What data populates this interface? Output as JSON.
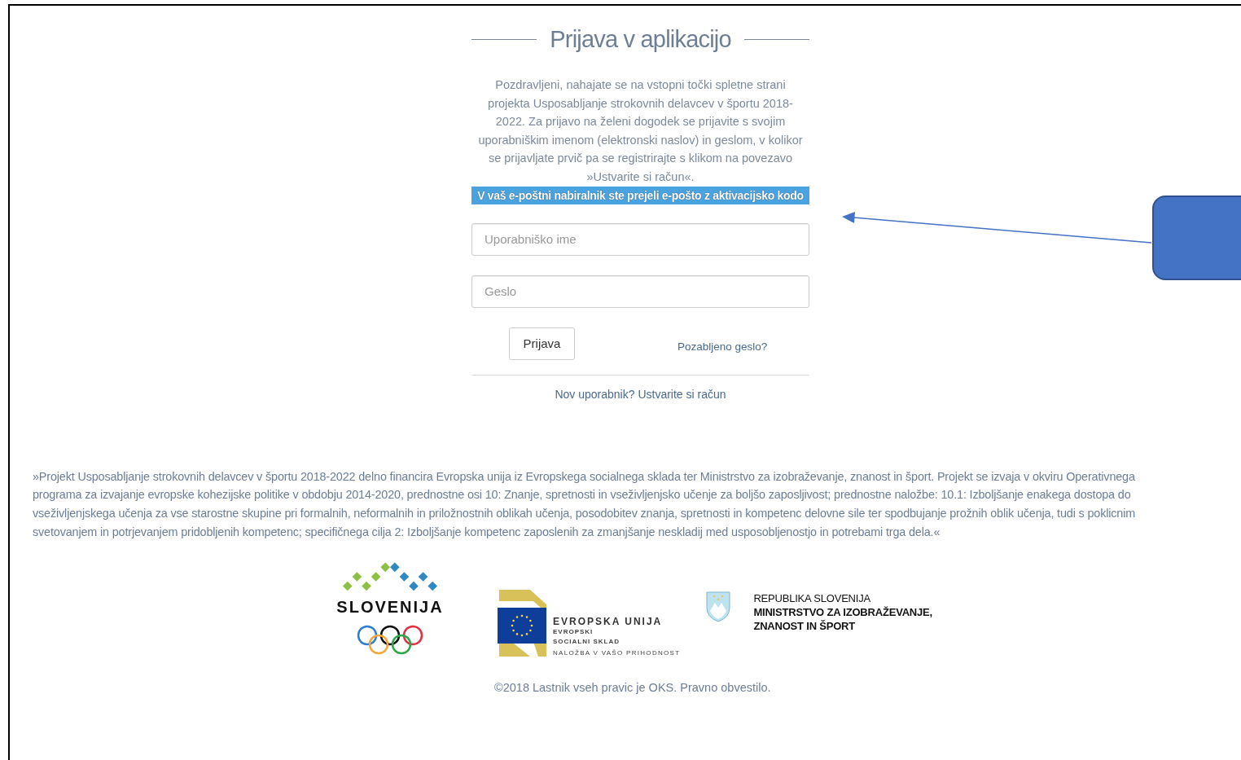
{
  "title": "Prijava v aplikacijo",
  "intro": "Pozdravljeni, nahajate se na vstopni točki spletne strani projekta Usposabljanje strokovnih delavcev v športu 2018-2022. Za prijavo na želeni dogodek se prijavite s svojim uporabniškim imenom (elektronski naslov) in geslom, v kolikor se prijavljate prvič pa se registrirajte s klikom na povezavo »Ustvarite si račun«.",
  "alert": "V vaš e-poštni nabiralnik ste prejeli e-pošto z aktivacijsko kodo",
  "fields": [
    {
      "placeholder": "Uporabniško ime"
    },
    {
      "placeholder": "Geslo"
    }
  ],
  "login_button": "Prijava",
  "forgot_link": "Pozabljeno geslo?",
  "register_link": "Nov uporabnik? Ustvarite si račun",
  "funding_lines": [
    "»Projekt Usposabljanje strokovnih delavcev v športu 2018-2022 delno financira Evropska unija iz Evropskega socialnega sklada ter Ministrstvo za izobraževanje, znanost in šport. Projekt se izvaja v okviru Operativnega",
    "programa za izvajanje evropske kohezijske politike v obdobju 2014-2020, prednostne osi 10: Znanje, spretnosti in vseživljenjsko učenje za boljšo zaposljivost; prednostne naložbe: 10.1: Izboljšanje enakega dostopa do",
    "vseživljenjskega učenja za vse starostne skupine pri formalnih, neformalnih in priložnostnih oblikah učenja, posodobitev znanja, spretnosti in kompetenc delovne sile ter spodbujanje prožnih oblik učenja, tudi s poklicnim",
    "svetovanjem in potrjevanjem pridobljenih kompetenc; specifičnega cilja 2: Izboljšanje kompetenc zaposlenih za zmanjšanje neskladij med usposobljenostjo in potrebami trga dela.«"
  ],
  "logos": {
    "slovenija": {
      "wordmark": "SLOVENIJA"
    },
    "eu": {
      "title": "EVROPSKA UNIJA",
      "lines": [
        "EVROPSKI",
        "SOCIALNI SKLAD"
      ],
      "slogan": "NALOŽBA V VAŠO PRIHODNOST"
    },
    "ministry": {
      "lines": [
        "REPUBLIKA SLOVENIJA",
        "MINISTRSTVO ZA IZOBRAŽEVANJE,",
        "ZNANOST IN ŠPORT"
      ]
    }
  },
  "copyright": "©2018 Lastnik vseh pravic je OKS. Pravno obvestilo."
}
